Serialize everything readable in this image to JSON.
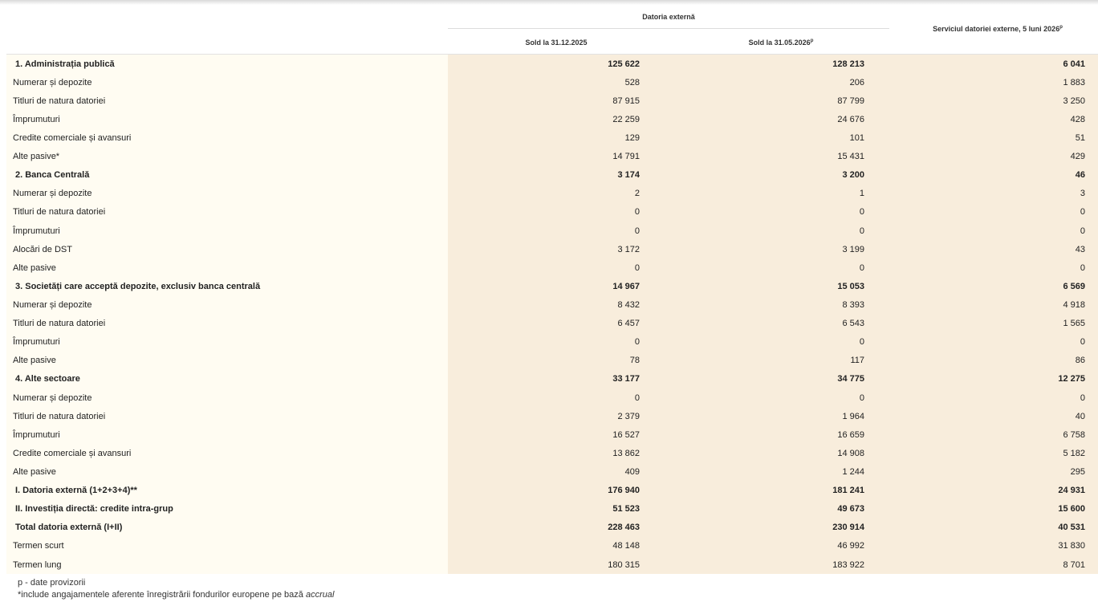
{
  "header": {
    "group_title": "Datoria externă",
    "col1": "Sold la 31.12.2025",
    "col2": "Sold la 31.05.2026",
    "col2_sup": "p",
    "col3": "Serviciul datoriei externe, 5 luni 2026",
    "col3_sup": "p"
  },
  "rows": [
    {
      "label": "1. Administrația publică",
      "v1": "125 622",
      "v2": "128 213",
      "v3": "6 041",
      "bold": true
    },
    {
      "label": "Numerar și depozite",
      "v1": "528",
      "v2": "206",
      "v3": "1 883",
      "bold": false
    },
    {
      "label": "Titluri de natura datoriei",
      "v1": "87 915",
      "v2": "87 799",
      "v3": "3 250",
      "bold": false
    },
    {
      "label": "Împrumuturi",
      "v1": "22 259",
      "v2": "24 676",
      "v3": "428",
      "bold": false
    },
    {
      "label": "Credite comerciale și avansuri",
      "v1": "129",
      "v2": "101",
      "v3": "51",
      "bold": false
    },
    {
      "label": "Alte pasive*",
      "v1": "14 791",
      "v2": "15 431",
      "v3": "429",
      "bold": false
    },
    {
      "label": "2. Banca Centrală",
      "v1": "3 174",
      "v2": "3 200",
      "v3": "46",
      "bold": true
    },
    {
      "label": "Numerar și depozite",
      "v1": "2",
      "v2": "1",
      "v3": "3",
      "bold": false
    },
    {
      "label": "Titluri de natura datoriei",
      "v1": "0",
      "v2": "0",
      "v3": "0",
      "bold": false
    },
    {
      "label": "Împrumuturi",
      "v1": "0",
      "v2": "0",
      "v3": "0",
      "bold": false
    },
    {
      "label": "Alocări de DST",
      "v1": "3 172",
      "v2": "3 199",
      "v3": "43",
      "bold": false
    },
    {
      "label": "Alte pasive",
      "v1": "0",
      "v2": "0",
      "v3": "0",
      "bold": false
    },
    {
      "label": "3. Societăți care acceptă depozite, exclusiv banca centrală",
      "v1": "14 967",
      "v2": "15 053",
      "v3": "6 569",
      "bold": true
    },
    {
      "label": "Numerar și depozite",
      "v1": "8 432",
      "v2": "8 393",
      "v3": "4 918",
      "bold": false
    },
    {
      "label": "Titluri de natura datoriei",
      "v1": "6 457",
      "v2": "6 543",
      "v3": "1 565",
      "bold": false
    },
    {
      "label": "Împrumuturi",
      "v1": "0",
      "v2": "0",
      "v3": "0",
      "bold": false
    },
    {
      "label": "Alte pasive",
      "v1": "78",
      "v2": "117",
      "v3": "86",
      "bold": false
    },
    {
      "label": "4. Alte sectoare",
      "v1": "33 177",
      "v2": "34 775",
      "v3": "12 275",
      "bold": true
    },
    {
      "label": "Numerar și depozite",
      "v1": "0",
      "v2": "0",
      "v3": "0",
      "bold": false
    },
    {
      "label": "Titluri de natura datoriei",
      "v1": "2 379",
      "v2": "1 964",
      "v3": "40",
      "bold": false
    },
    {
      "label": "Împrumuturi",
      "v1": "16 527",
      "v2": "16 659",
      "v3": "6 758",
      "bold": false
    },
    {
      "label": "Credite comerciale și avansuri",
      "v1": "13 862",
      "v2": "14 908",
      "v3": "5 182",
      "bold": false
    },
    {
      "label": "Alte pasive",
      "v1": "409",
      "v2": "1 244",
      "v3": "295",
      "bold": false
    },
    {
      "label": "I. Datoria externă (1+2+3+4)**",
      "v1": "176 940",
      "v2": "181 241",
      "v3": "24 931",
      "bold": true
    },
    {
      "label": "II. Investiția directă: credite intra-grup",
      "v1": "51 523",
      "v2": "49 673",
      "v3": "15 600",
      "bold": true
    },
    {
      "label": "Total datoria externă (I+II)",
      "v1": "228 463",
      "v2": "230 914",
      "v3": "40 531",
      "bold": true
    },
    {
      "label": "Termen scurt",
      "v1": "48 148",
      "v2": "46 992",
      "v3": "31 830",
      "bold": false
    },
    {
      "label": "Termen lung",
      "v1": "180 315",
      "v2": "183 922",
      "v3": "8 701",
      "bold": false
    }
  ],
  "notes": {
    "line1": "p - date provizorii",
    "line2": "*include angajamentele aferente înregistrării fondurilor europene pe bază",
    "line2_italic": "accrual"
  },
  "colors": {
    "label_bg": "#fffcf2",
    "value_bg": "#f8eddc"
  }
}
